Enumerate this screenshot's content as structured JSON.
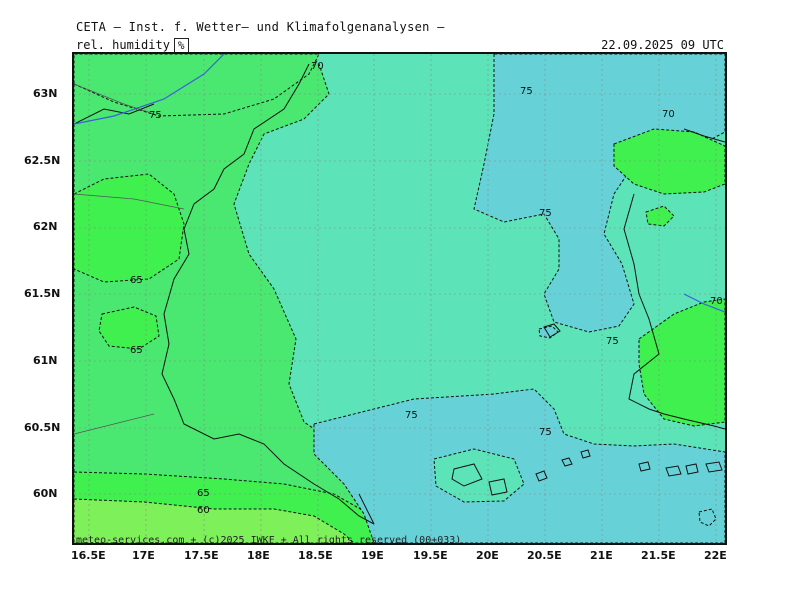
{
  "header": {
    "title": "CETA — Inst. f. Wetter— und Klimafolgenanalysen —",
    "variable": "rel. humidity",
    "unit": "%",
    "datetime": "22.09.2025 09 UTC"
  },
  "footer": {
    "credit": "meteo-services.com + (c)2025 IWKF + All rights reserved (00+033)"
  },
  "axes": {
    "longitude_ticks": [
      "16.5E",
      "17E",
      "17.5E",
      "18E",
      "18.5E",
      "19E",
      "19.5E",
      "20E",
      "20.5E",
      "21E",
      "21.5E",
      "22E"
    ],
    "latitude_ticks": [
      "63N",
      "62.5N",
      "62N",
      "61.5N",
      "61N",
      "60.5N",
      "60N"
    ]
  },
  "contour_labels": [
    "70",
    "75",
    "75",
    "75",
    "70",
    "65",
    "65",
    "75",
    "75",
    "75",
    "70",
    "65",
    "60"
  ],
  "colors": {
    "humidity_60": "#7ef05a",
    "humidity_65": "#3ff04e",
    "humidity_70": "#4ae870",
    "humidity_75": "#5ce3b8",
    "humidity_80": "#66d2d8",
    "contour": "#111111",
    "coast": "#111111",
    "river": "#3a5fe0",
    "grid": "#888888"
  }
}
